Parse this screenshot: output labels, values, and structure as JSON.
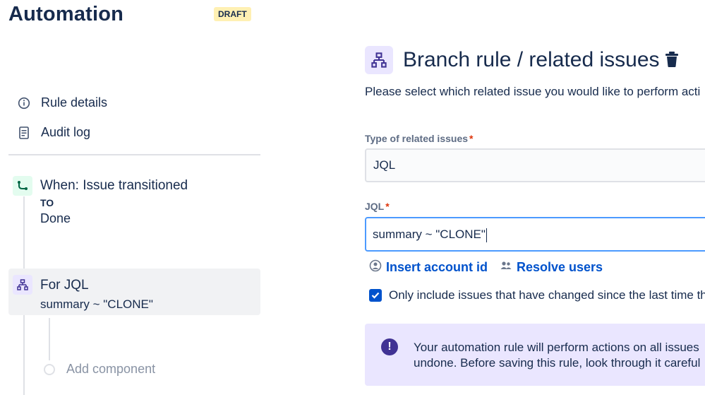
{
  "header": {
    "title": "Automation",
    "badge": "DRAFT"
  },
  "sidebar": {
    "links": [
      {
        "label": "Rule details",
        "icon": "info-circle-icon"
      },
      {
        "label": "Audit log",
        "icon": "document-icon"
      }
    ]
  },
  "trigger": {
    "title": "When: Issue transitioned",
    "to_label": "TO",
    "to_value": "Done",
    "icon": "transition-icon"
  },
  "branch": {
    "title": "For JQL",
    "value": "summary ~ \"CLONE\"",
    "icon": "branch-hierarchy-icon"
  },
  "add_component": {
    "label": "Add component"
  },
  "panel": {
    "title": "Branch rule / related issues",
    "description": "Please select which related issue you would like to perform acti",
    "type_field": {
      "label": "Type of related issues",
      "required_mark": "*",
      "value": "JQL"
    },
    "jql_field": {
      "label": "JQL",
      "required_mark": "*",
      "value": "summary ~ \"CLONE\""
    },
    "links": {
      "insert_account_id": "Insert account id",
      "resolve_users": "Resolve users"
    },
    "checkbox": {
      "label": "Only include issues that have changed since the last time th",
      "checked": true
    },
    "info": {
      "line1": "Your automation rule will perform actions on all issues",
      "line2": "undone. Before saving this rule, look through it careful"
    }
  },
  "colors": {
    "brand_blue": "#0052cc",
    "focus_border": "#4c9aff",
    "draft_bg": "#fff0b3",
    "branch_bg": "#eae6ff",
    "trigger_bg": "#e3fcef",
    "info_icon": "#403294",
    "required": "#de350b"
  }
}
